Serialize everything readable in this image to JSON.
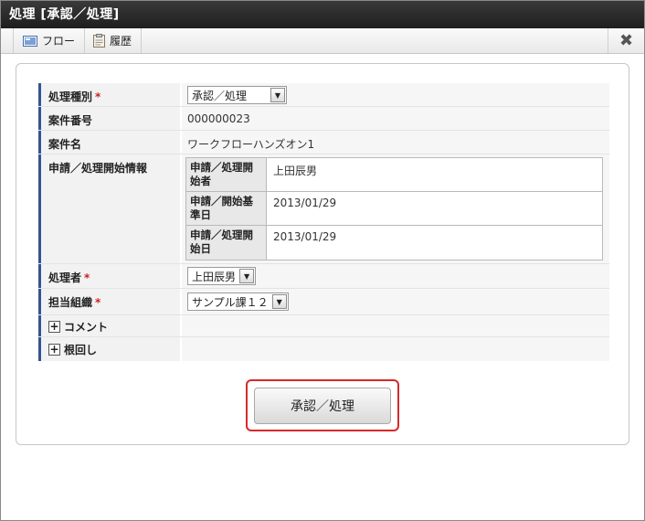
{
  "window": {
    "title": "処理 [承認／処理]"
  },
  "toolbar": {
    "flow_label": "フロー",
    "history_label": "履歴"
  },
  "form": {
    "process_type": {
      "label": "処理種別",
      "required_mark": "*",
      "value": "承認／処理"
    },
    "case_number": {
      "label": "案件番号",
      "value": "000000023"
    },
    "case_name": {
      "label": "案件名",
      "value": "ワークフローハンズオン1"
    },
    "start_info": {
      "label": "申請／処理開始情報",
      "rows": [
        {
          "label": "申請／処理開始者",
          "value": "上田辰男"
        },
        {
          "label": "申請／開始基準日",
          "value": "2013/01/29"
        },
        {
          "label": "申請／処理開始日",
          "value": "2013/01/29"
        }
      ]
    },
    "processor": {
      "label": "処理者",
      "required_mark": "*",
      "value": "上田辰男"
    },
    "organization": {
      "label": "担当組織",
      "required_mark": "*",
      "value": "サンプル課１２"
    },
    "comment": {
      "label": "コメント"
    },
    "nemawashi": {
      "label": "根回し"
    }
  },
  "actions": {
    "submit_label": "承認／処理"
  },
  "colors": {
    "title_bg": "#2a2a2a",
    "label_accent": "#33558f",
    "required": "#d02020",
    "highlight": "#d52a2a"
  }
}
